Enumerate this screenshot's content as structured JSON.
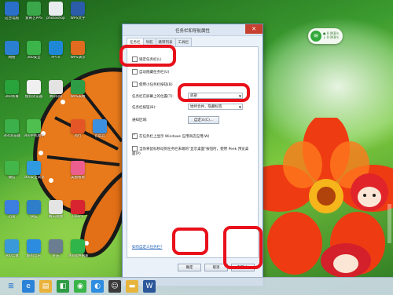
{
  "dialog": {
    "title": "任务栏和导航属性",
    "close_glyph": "✕",
    "tabs": [
      "任务栏",
      "导航",
      "跳转列表",
      "工具栏"
    ],
    "lock_taskbar": {
      "label": "锁定任务栏(L)",
      "checked": false
    },
    "auto_hide": {
      "label": "自动隐藏任务栏(U)",
      "checked": false
    },
    "small_buttons": {
      "label": "使用小任务栏按钮(B)",
      "checked": false
    },
    "location": {
      "label": "任务栏在屏幕上的位置(T):",
      "value": "底部"
    },
    "buttons": {
      "label": "任务栏按钮(B):",
      "value": "始终合并，隐藏标签"
    },
    "notification": {
      "label": "通知区域:",
      "button": "自定义(C)..."
    },
    "store_apps": {
      "label": "在任务栏上显示 Windows 应用商店应用(W)",
      "checked": true
    },
    "peek": {
      "label": "当你将鼠标移动到任务栏末端的\"显示桌面\"按钮时，使用 Peek 预览桌面(P)",
      "checked": false
    },
    "help_link": "如何自定义任务栏?",
    "ok_button": "确定",
    "cancel_button": "取消",
    "apply_button": "应用(A)"
  },
  "desktop_icons": [
    {
      "label": "这台电脑",
      "color": "#2a6fc9",
      "glyph": "🖥"
    },
    {
      "label": "爱奇艺PPS",
      "color": "#3aa84a",
      "glyph": "▶"
    },
    {
      "label": "photoshop",
      "color": "#e9ecef",
      "glyph": "⚙"
    },
    {
      "label": "WPS文字",
      "color": "#2a5caa",
      "glyph": "W"
    },
    {
      "label": "网络",
      "color": "#2a7fd0",
      "glyph": "◉"
    },
    {
      "label": "360安全",
      "color": "#3bb54a",
      "glyph": "◆"
    },
    {
      "label": "PPTV",
      "color": "#1e88d6",
      "glyph": "P"
    },
    {
      "label": "WPS演示",
      "color": "#e06a1f",
      "glyph": "P"
    },
    {
      "label": "360杀毒",
      "color": "#29a33b",
      "glyph": "◈"
    },
    {
      "label": "搜狗浏览器",
      "color": "#f0f0f0",
      "glyph": "◐"
    },
    {
      "label": "WPS表格",
      "color": "#2e9b45",
      "glyph": "S"
    },
    {
      "label": "腾讯QQ",
      "color": "#e3e3e3",
      "glyph": "☺"
    },
    {
      "label": "360浏览器",
      "color": "#3bb04b",
      "glyph": "e"
    },
    {
      "label": "风行",
      "color": "#e55627",
      "glyph": "F"
    },
    {
      "label": "百度云",
      "color": "#3d8fe0",
      "glyph": "☁"
    },
    {
      "label": "360手机助手",
      "color": "#4fbf4f",
      "glyph": "▣"
    },
    {
      "label": "微信",
      "color": "#43b649",
      "glyph": "✉"
    },
    {
      "label": "美图看看",
      "color": "#ec5e8d",
      "glyph": "✿"
    },
    {
      "label": "360安全浏览器",
      "color": "#2f9ae0",
      "glyph": "⊕"
    },
    {
      "label": "迅雷",
      "color": "#3c7fe0",
      "glyph": "✈"
    },
    {
      "label": "快压",
      "color": "#2e7ec9",
      "glyph": "⬇"
    },
    {
      "label": "腾讯视频",
      "color": "#e4e4e4",
      "glyph": "▶"
    },
    {
      "label": "Opera",
      "color": "#d82431",
      "glyph": "O"
    },
    {
      "label": "360云盘",
      "color": "#3a9ad9",
      "glyph": "☁"
    },
    {
      "label": "酷狗音乐",
      "color": "#2b8ce0",
      "glyph": "K"
    },
    {
      "label": "好压",
      "color": "#6a7d91",
      "glyph": "▦"
    },
    {
      "label": "360软件管家",
      "color": "#2fb54a",
      "glyph": "⌂"
    }
  ],
  "gadget": {
    "line1": "● 0.0KB/s",
    "line2": "↓ 0.0KB/s"
  },
  "taskbar_items": [
    {
      "name": "start-icon",
      "glyph": "⊞",
      "color": "#1e6fd0"
    },
    {
      "name": "ie-icon",
      "glyph": "e",
      "color": "#2a83d8"
    },
    {
      "name": "explorer-icon",
      "glyph": "▤",
      "color": "#e9b23a"
    },
    {
      "name": "store-icon",
      "glyph": "◧",
      "color": "#2e9b45"
    },
    {
      "name": "360-icon",
      "glyph": "◉",
      "color": "#3bb54a"
    },
    {
      "name": "browser-icon",
      "glyph": "◐",
      "color": "#2e8de0"
    },
    {
      "name": "qq-icon",
      "glyph": "☺",
      "color": "#3a3a3a"
    },
    {
      "name": "folder-icon",
      "glyph": "▬",
      "color": "#e7b53c"
    },
    {
      "name": "word-icon",
      "glyph": "W",
      "color": "#2b579a"
    }
  ]
}
